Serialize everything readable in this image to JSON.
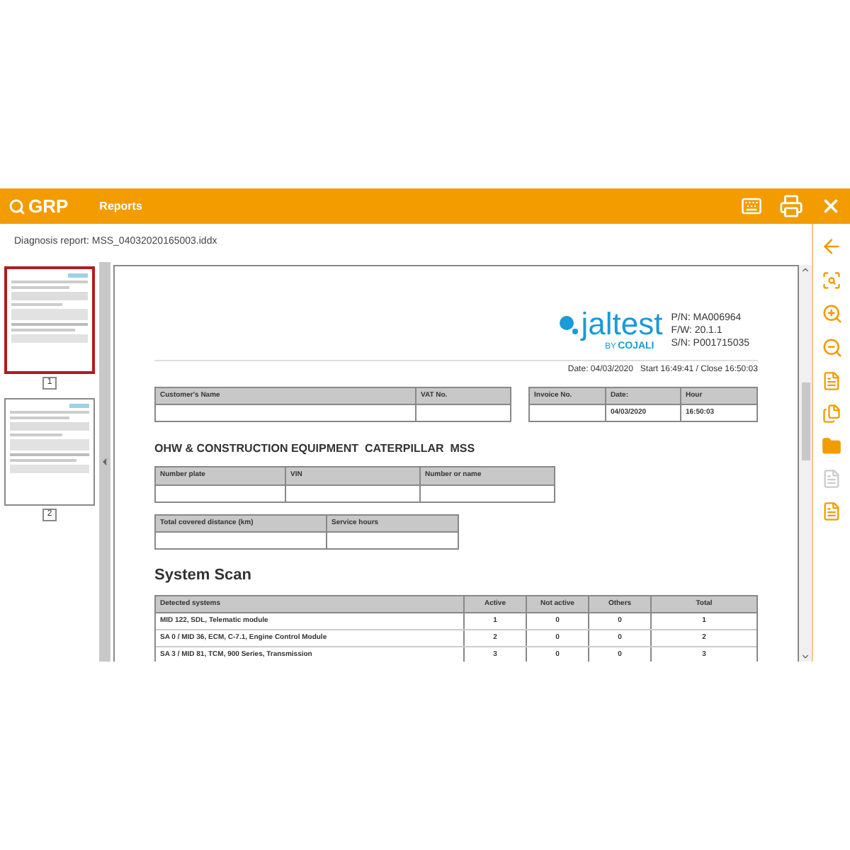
{
  "app_bar": {
    "logo": "GRP",
    "title": "Reports"
  },
  "subheader": {
    "title": "Diagnosis report: MSS_04032020165003.iddx"
  },
  "thumbnails": [
    {
      "label": "1",
      "selected": true
    },
    {
      "label": "2",
      "selected": false
    }
  ],
  "document": {
    "brand": {
      "name": "jaltest",
      "byline": "BY",
      "company": "COJALI"
    },
    "device_info": [
      "P/N: MA006964",
      "F/W: 20.1.1",
      "S/N: P001715035"
    ],
    "date_line": "Date: 04/03/2020   Start 16:49:41 / Close 16:50:03",
    "customer_table": {
      "columns": [
        "Customer's Name",
        "VAT No."
      ]
    },
    "invoice_table": {
      "columns": [
        "Invoice No.",
        "Date:",
        "Hour"
      ],
      "date": "04/03/2020",
      "hour": "16:50:03"
    },
    "heading": "OHW & CONSTRUCTION EQUIPMENT  CATERPILLAR  MSS",
    "vehicle_table": {
      "columns": [
        "Number plate",
        "VIN",
        "Number or name"
      ]
    },
    "usage_table": {
      "columns": [
        "Total covered distance (km)",
        "Service hours"
      ]
    },
    "scan_title": "System Scan",
    "scan_table": {
      "columns": [
        "Detected systems",
        "Active",
        "Not active",
        "Others",
        "Total"
      ],
      "rows": [
        [
          "MID 122, SDL, Telematic module",
          "1",
          "0",
          "0",
          "1"
        ],
        [
          "SA 0 / MID 36, ECM, C-7.1, Engine Control Module",
          "2",
          "0",
          "0",
          "2"
        ],
        [
          "SA 3 / MID 81, TCM, 900 Series, Transmission",
          "3",
          "0",
          "0",
          "3"
        ]
      ]
    }
  }
}
